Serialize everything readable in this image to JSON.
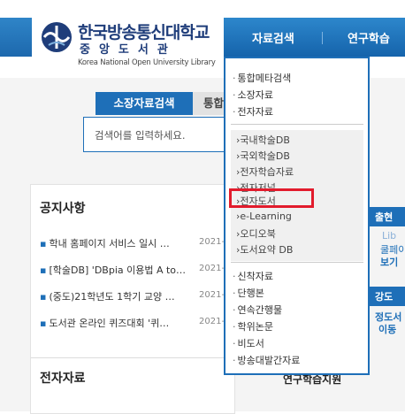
{
  "header": {
    "logo_ko": "한국방송통신대학교",
    "logo_sub": "중앙도서관",
    "logo_en": "Korea National Open University Library"
  },
  "gnb": {
    "items": [
      {
        "label": "자료검색"
      },
      {
        "label": "연구학습"
      }
    ]
  },
  "search": {
    "tab_active": "소장자료검색",
    "tab_inactive": "통합",
    "placeholder": "검색어를 입력하세요."
  },
  "notice": {
    "title": "공지사항",
    "items": [
      {
        "text": "학내 홈페이지 서비스 일시 …",
        "date": "2021-"
      },
      {
        "text": "[학술DB] 'DBpia 이용법 A to…",
        "date": "2021-"
      },
      {
        "text": "(중도)21학년도 1학기 교양 …",
        "date": "2021-"
      },
      {
        "text": "도서관 온라인 퀴즈대회 '퀴…",
        "date": "2021-"
      }
    ]
  },
  "ejr": {
    "title": "전자자료"
  },
  "right_peek": {
    "t1": "출현",
    "t2": "Lib",
    "t3": "쿨페이",
    "t4": "보기",
    "t5": "강도",
    "t6": "정도서",
    "t7": "이동",
    "t8": "연구학습지원"
  },
  "dropdown": {
    "group1": [
      "통합메타검색",
      "소장자료",
      "전자자료"
    ],
    "group2": [
      "국내학술DB",
      "국외학술DB",
      "전자학습자료",
      "전자저널",
      "전자도서",
      "e-Learning",
      "오디오북",
      "도서요약 DB"
    ],
    "group3": [
      "신착자료",
      "단행본",
      "연속간행물",
      "학위논문",
      "비도서",
      "방송대발간자료"
    ]
  },
  "colors": {
    "brand_blue": "#1e6fb8",
    "highlight_red": "#e21b2c"
  }
}
